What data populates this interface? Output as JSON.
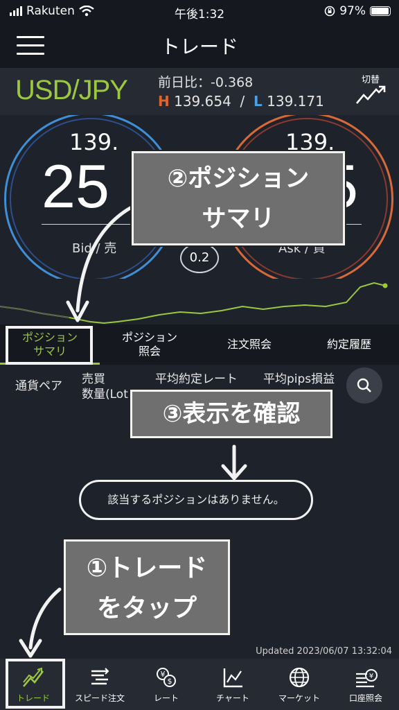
{
  "status_bar": {
    "carrier": "Rakuten",
    "time": "午後1:32",
    "battery": "97%",
    "battery_level": 0.97
  },
  "header": {
    "title": "トレード"
  },
  "pair": {
    "name": "USD/JPY",
    "diff": "前日比：-0.368",
    "high_label": "H",
    "high": "139.654",
    "sep": "/",
    "low_label": "L",
    "low": "139.171",
    "switch_label": "切替"
  },
  "prices": {
    "bid_top": "139.",
    "bid_big": "25",
    "bid_label": "Bid / 売",
    "ask_top": "139.",
    "ask_big": "5",
    "ask_label": "Ask / 買",
    "spread": "0.2"
  },
  "tabs": [
    {
      "label": "ポジション\nサマリ"
    },
    {
      "label": "ポジション\n照会"
    },
    {
      "label": "注文照会"
    },
    {
      "label": "約定履歴"
    }
  ],
  "columns": {
    "pair": "通貨ペア",
    "side": "売買\n数量(Lot)",
    "rate": "平均約定レート",
    "pips": "平均pips損益"
  },
  "empty_message": "該当するポジションはありません。",
  "callouts": {
    "c1": "①トレード\nをタップ",
    "c2": "②ポジション\nサマリ",
    "c3": "③表示を確認"
  },
  "updated": "Updated  2023/06/07 13:32:04",
  "nav": [
    {
      "label": "トレード",
      "icon": "trade-icon"
    },
    {
      "label": "スピード注文",
      "icon": "speed-order-icon"
    },
    {
      "label": "レート",
      "icon": "rate-icon"
    },
    {
      "label": "チャート",
      "icon": "chart-icon"
    },
    {
      "label": "マーケット",
      "icon": "globe-icon"
    },
    {
      "label": "口座照会",
      "icon": "account-icon"
    }
  ],
  "colors": {
    "accent": "#9cc840",
    "high": "#e0642b",
    "low": "#4aa1e8",
    "bid_ring": "#3f8fd6",
    "ask_ring": "#d86a3a"
  }
}
